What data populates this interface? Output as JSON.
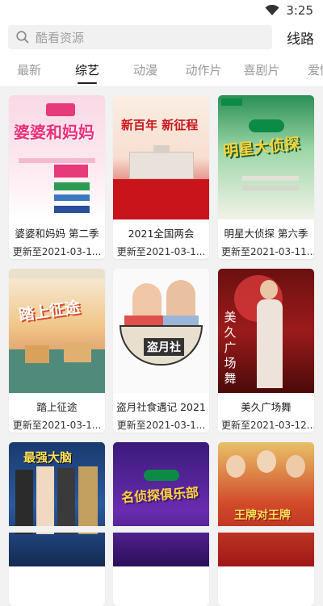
{
  "statusbar": {
    "time": "3:25"
  },
  "search": {
    "placeholder": "酷看资源"
  },
  "header": {
    "route_label": "线路"
  },
  "tabs": [
    {
      "label": "最新"
    },
    {
      "label": "综艺"
    },
    {
      "label": "动漫"
    },
    {
      "label": "动作片"
    },
    {
      "label": "喜剧片"
    },
    {
      "label": "爱情"
    }
  ],
  "active_tab": "综艺",
  "cards": [
    {
      "title": "婆婆和妈妈 第二季",
      "update": "更新至2021-03-1...",
      "poster_text": "婆婆和妈妈"
    },
    {
      "title": "2021全国两会",
      "update": "更新至2021-03-1...",
      "poster_text": "新百年 新征程"
    },
    {
      "title": "明星大侦探 第六季",
      "update": "更新至2021-03-11...",
      "poster_text": "明星大侦探"
    },
    {
      "title": "踏上征途",
      "update": "更新至2021-03-1...",
      "poster_text": "踏上征途"
    },
    {
      "title": "盗月社食遇记 2021",
      "update": "更新至2021-03-1...",
      "poster_text": "盗月社"
    },
    {
      "title": "美久广场舞",
      "update": "更新至2021-03-12...",
      "poster_text": "美久广场舞"
    },
    {
      "title": "",
      "update": "",
      "poster_text": "最强大脑"
    },
    {
      "title": "",
      "update": "",
      "poster_text": "名侦探俱乐部"
    },
    {
      "title": "",
      "update": "",
      "poster_text": "王牌对王牌"
    }
  ],
  "colors": {
    "accent": "#222222",
    "tab_inactive": "#9a9a9a",
    "search_bg": "#f1f1f1",
    "page_bg": "#f2f2f2"
  }
}
